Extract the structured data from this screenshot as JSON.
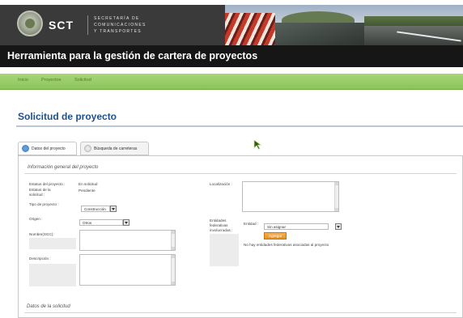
{
  "header": {
    "brand": "SCT",
    "brand_sub": [
      "SECRETARÍA DE",
      "COMUNICACIONES",
      "Y TRANSPORTES"
    ],
    "app_title": "Herramienta para la gestión de cartera de proyectos"
  },
  "nav": {
    "items": [
      "Inicio",
      "Proyectos",
      "Solicitud"
    ]
  },
  "page": {
    "title": "Solicitud de proyecto"
  },
  "tabs": [
    {
      "label": "Datos del proyecto",
      "active": true
    },
    {
      "label": "Búsqueda de carreteras",
      "active": false
    }
  ],
  "section": {
    "title": "Información general del proyecto"
  },
  "form": {
    "estatus_proyecto_label": "Estatus del proyecto :",
    "estatus_proyecto_value": "En solicitud",
    "estatus_solicitud_label_1": "Estatus de la",
    "estatus_solicitud_label_2": "solicitud :",
    "estatus_solicitud_value": "Pendiente",
    "tipo_label": "Tipo de proyecto :",
    "tipo_value": "Construcción",
    "origen_label": "Origen :",
    "origen_value": "Otros",
    "nombre_label": "Nombre(SGC):",
    "descripcion_label": "Descripción :",
    "localizacion_label": "Localización :",
    "entidades_label_1": "Entidades",
    "entidades_label_2": "federativas",
    "entidades_label_3": "involucradas :",
    "entidad_label": "Entidad :",
    "entidad_value": "Sin asignar",
    "agregar_label": "Agregar",
    "no_entidades_text": "No hay entidades federativas asociadas al proyecto"
  },
  "footer_section": {
    "title": "Datos de la solicitud"
  },
  "colors": {
    "header_bg": "#3a3a3a",
    "title_bar_bg": "#161616",
    "nav_green": "#8cc45a",
    "title_blue": "#1f4f8c",
    "button_orange": "#e8901f"
  }
}
